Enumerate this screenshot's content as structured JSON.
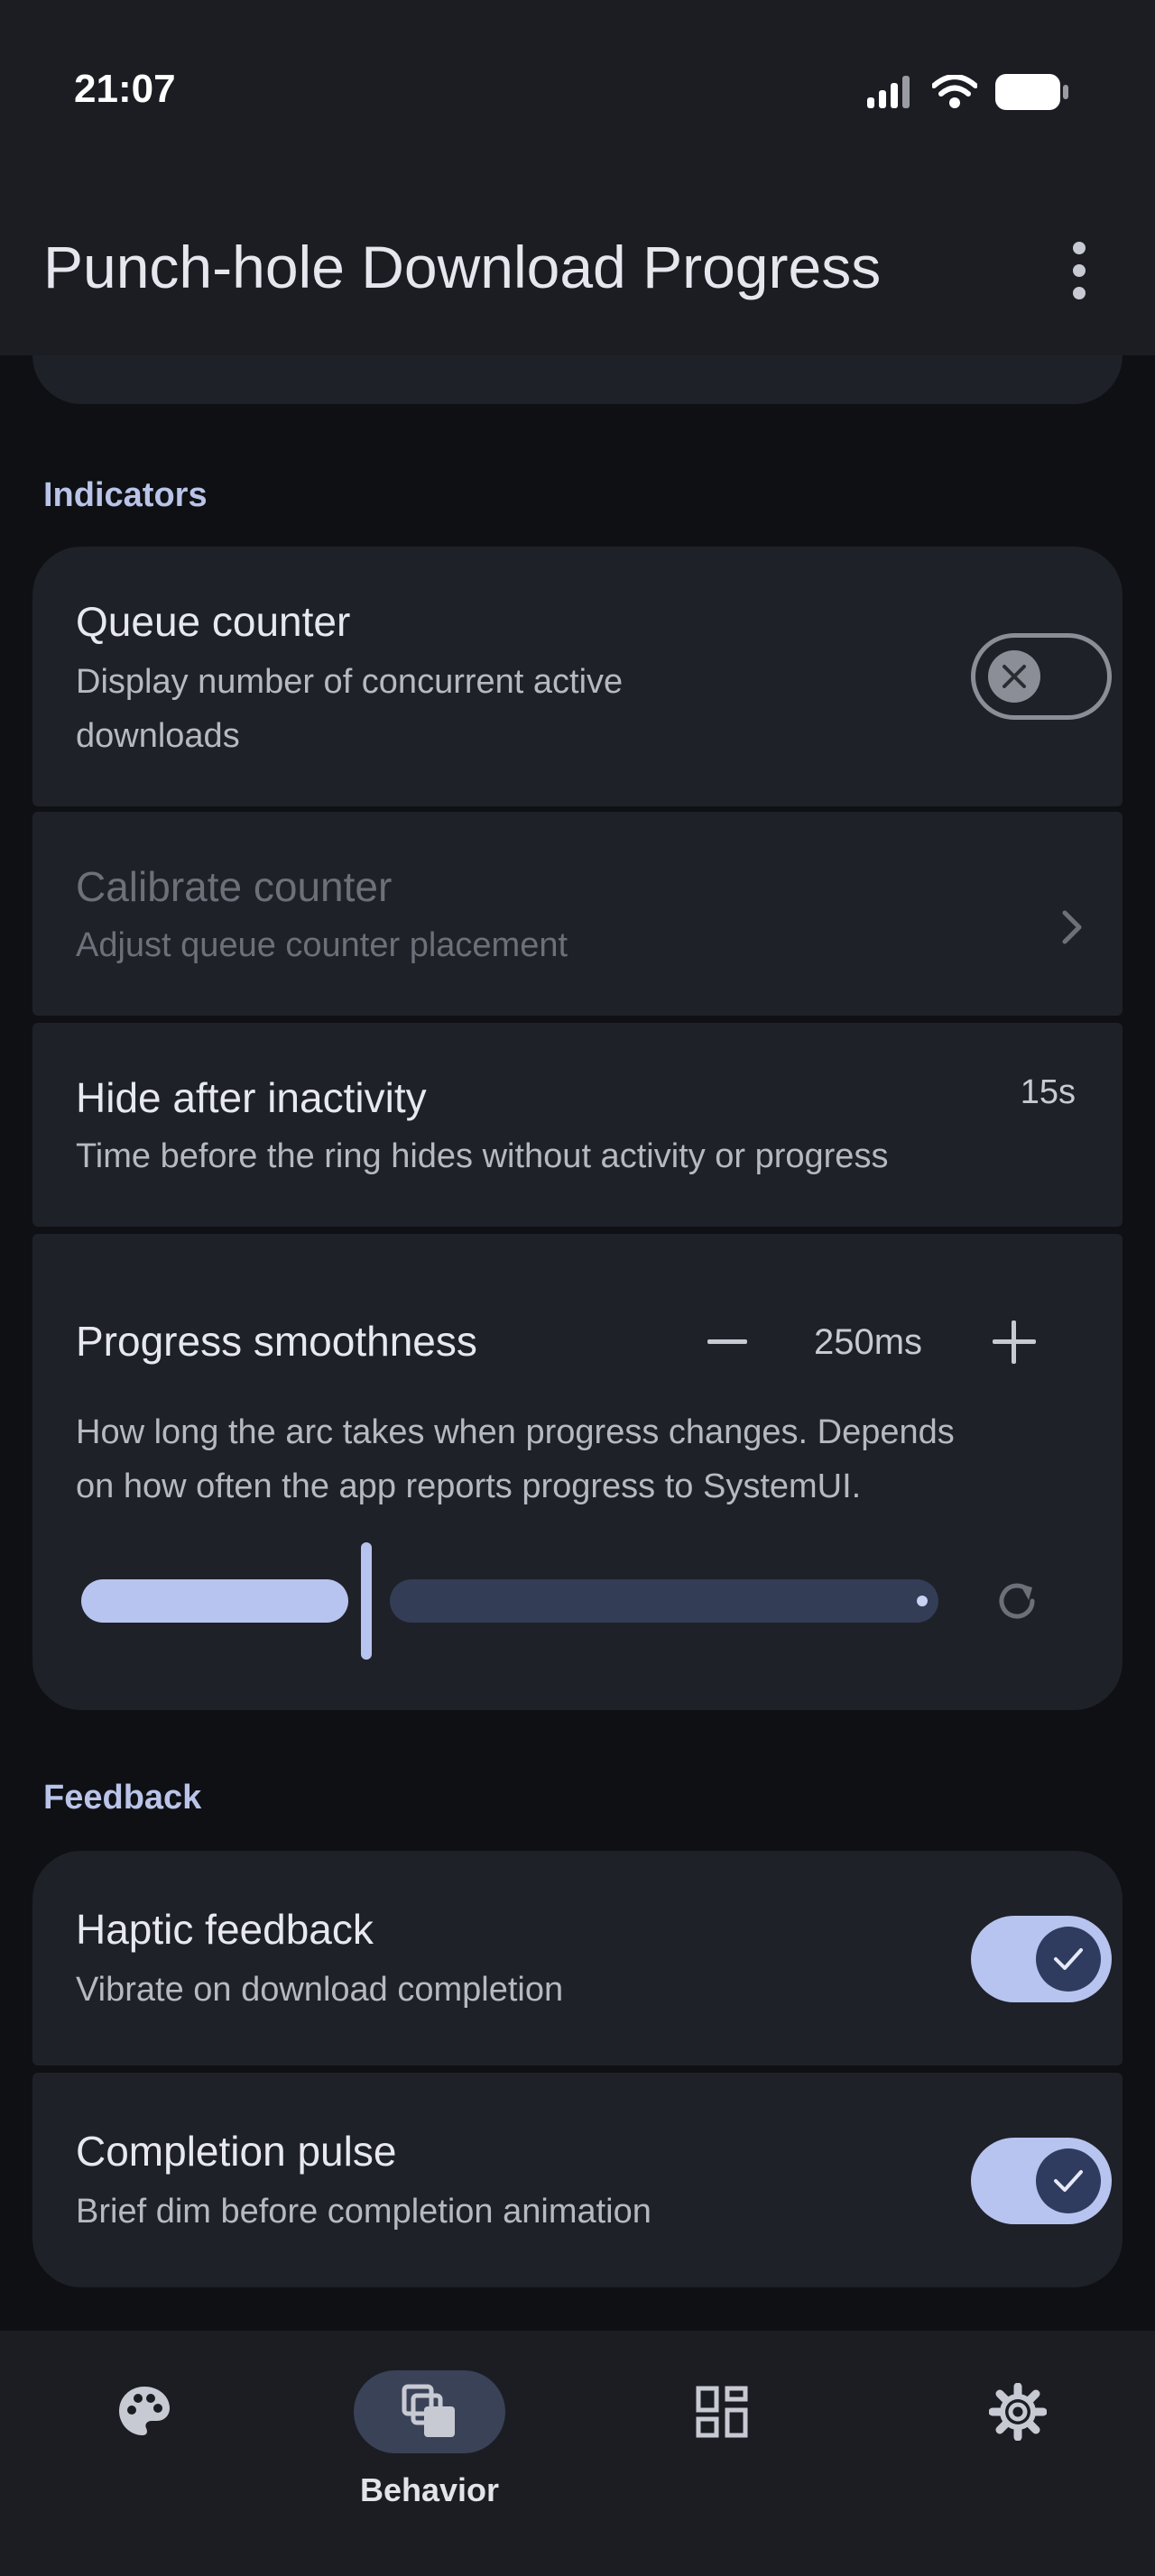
{
  "status_bar": {
    "time": "21:07"
  },
  "app_bar": {
    "title": "Punch-hole Download Progress"
  },
  "sections": {
    "indicators": {
      "header": "Indicators",
      "queue_counter": {
        "title": "Queue counter",
        "subtitle_line1": "Display number of concurrent active",
        "subtitle_line2": "downloads",
        "enabled": false
      },
      "calibrate_counter": {
        "title": "Calibrate counter",
        "subtitle": "Adjust queue counter placement"
      },
      "hide_after_inactivity": {
        "title": "Hide after inactivity",
        "subtitle": "Time before the ring hides without activity or progress",
        "value": "15s"
      },
      "progress_smoothness": {
        "title": "Progress smoothness",
        "value": "250ms",
        "description_line1": "How long the arc takes when progress changes. Depends",
        "description_line2": "on how often the app reports progress to SystemUI.",
        "slider_fraction": 0.33
      }
    },
    "feedback": {
      "header": "Feedback",
      "haptic_feedback": {
        "title": "Haptic feedback",
        "subtitle": "Vibrate on download completion",
        "enabled": true
      },
      "completion_pulse": {
        "title": "Completion pulse",
        "subtitle": "Brief dim before completion animation",
        "enabled": true
      }
    }
  },
  "bottom_nav": {
    "items": [
      {
        "icon": "palette-icon",
        "label": ""
      },
      {
        "icon": "behavior-icon",
        "label": "Behavior",
        "active": true
      },
      {
        "icon": "widgets-icon",
        "label": ""
      },
      {
        "icon": "gear-icon",
        "label": ""
      }
    ]
  },
  "colors": {
    "accent": "#b7c4ef",
    "surface": "#1f2129",
    "background": "#0f1014"
  }
}
